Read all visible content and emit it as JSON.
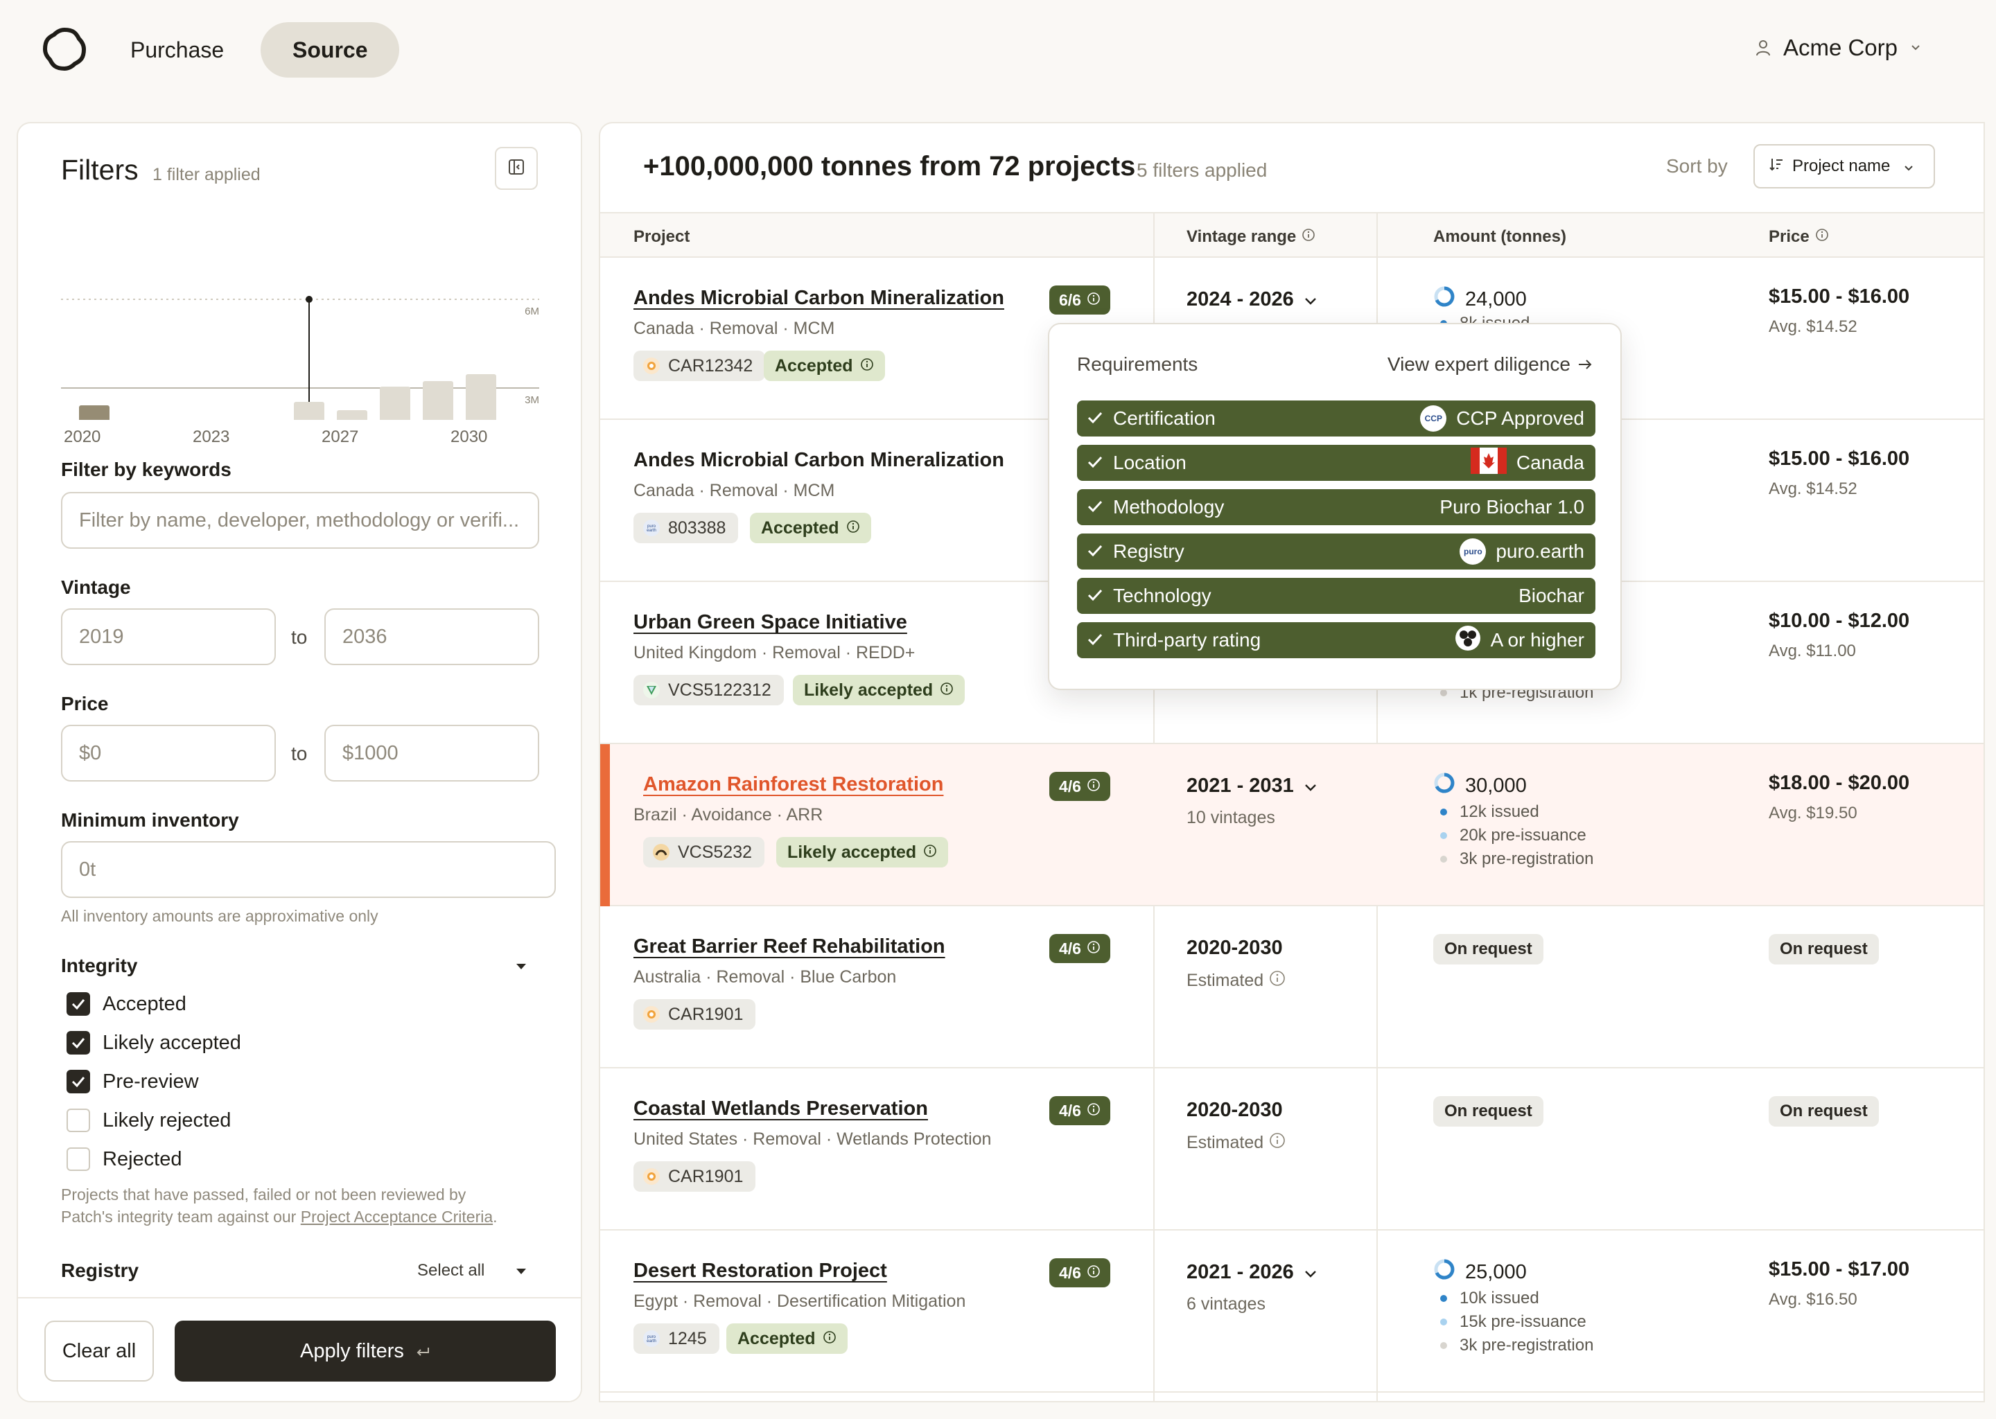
{
  "nav": {
    "tabs": [
      "Purchase",
      "Source"
    ],
    "account": "Acme Corp"
  },
  "filters": {
    "title": "Filters",
    "applied": "1 filter applied",
    "chart": {
      "y_ticks": [
        "6M",
        "3M"
      ],
      "x_ticks": [
        "2020",
        "2023",
        "2027",
        "2030"
      ]
    },
    "keywords": {
      "label": "Filter by keywords",
      "placeholder": "Filter by name, developer, methodology or verifi..."
    },
    "vintage": {
      "label": "Vintage",
      "from": "2019",
      "to_label": "to",
      "to": "2036"
    },
    "price": {
      "label": "Price",
      "from": "$0",
      "to_label": "to",
      "to": "$1000"
    },
    "inventory": {
      "label": "Minimum inventory",
      "value": "0t",
      "hint": "All inventory amounts are approximative only"
    },
    "integrity": {
      "label": "Integrity",
      "options": [
        {
          "label": "Accepted",
          "checked": true
        },
        {
          "label": "Likely accepted",
          "checked": true
        },
        {
          "label": "Pre-review",
          "checked": true
        },
        {
          "label": "Likely rejected",
          "checked": false
        },
        {
          "label": "Rejected",
          "checked": false
        }
      ],
      "hint_prefix": "Projects that have passed, failed or not been reviewed by",
      "hint_mid": "Patch's integrity team against our ",
      "hint_link": "Project Acceptance Criteria",
      "hint_suffix": "."
    },
    "registry": {
      "label": "Registry",
      "select_all": "Select all"
    },
    "clear_all": "Clear all",
    "apply": "Apply filters"
  },
  "results": {
    "title": "+100,000,000 tonnes from 72 projects",
    "applied": "5 filters applied",
    "sort_label": "Sort by",
    "sort_value": "Project name",
    "columns": [
      "Project",
      "Vintage range",
      "Amount (tonnes)",
      "Price"
    ],
    "rows": [
      {
        "name": "Andes Microbial Carbon Mineralization",
        "meta": "Canada · Removal · MCM",
        "registry_id": "CAR12342",
        "status": "Accepted",
        "score": "6/6",
        "vintage": "2024 - 2026",
        "vintage_sub": "",
        "amount": "24,000",
        "amount_lines": [
          "8k issued"
        ],
        "price": "$15.00 - $16.00",
        "avg": "Avg. $14.52"
      },
      {
        "name": "Andes Microbial Carbon Mineralization",
        "meta": "Canada · Removal · MCM",
        "registry_id": "803388",
        "status": "Accepted",
        "price": "$15.00 - $16.00",
        "avg": "Avg. $14.52"
      },
      {
        "name": "Urban Green Space Initiative",
        "meta": "United Kingdom · Removal · REDD+",
        "registry_id": "VCS5122312",
        "status": "Likely accepted",
        "amount_lines": [
          "1k pre-registration"
        ],
        "price": "$10.00 - $12.00",
        "avg": "Avg. $11.00"
      },
      {
        "name": "Amazon Rainforest Restoration",
        "meta": "Brazil  ·  Avoidance  ·  ARR",
        "registry_id": "VCS5232",
        "status": "Likely accepted",
        "score": "4/6",
        "vintage": "2021 - 2031",
        "vintage_sub": "10 vintages",
        "amount": "30,000",
        "amount_lines": [
          "12k issued",
          "20k pre-issuance",
          "3k pre-registration"
        ],
        "price": "$18.00 - $20.00",
        "avg": "Avg. $19.50"
      },
      {
        "name": "Great Barrier Reef Rehabilitation",
        "meta": "Australia  ·  Removal  ·  Blue Carbon",
        "registry_id": "CAR1901",
        "score": "4/6",
        "vintage": "2020-2030",
        "vintage_sub": "Estimated",
        "amount_onreq": "On request",
        "price_onreq": "On request"
      },
      {
        "name": "Coastal Wetlands Preservation",
        "meta": "United States  ·  Removal  ·  Wetlands Protection",
        "registry_id": "CAR1901",
        "score": "4/6",
        "vintage": "2020-2030",
        "vintage_sub": "Estimated",
        "amount_onreq": "On request",
        "price_onreq": "On request"
      },
      {
        "name": "Desert Restoration Project",
        "meta": "Egypt  ·  Removal  ·  Desertification Mitigation",
        "registry_id": "1245",
        "status": "Accepted",
        "score": "4/6",
        "vintage": "2021 - 2026",
        "vintage_sub": "6 vintages",
        "amount": "25,000",
        "amount_lines": [
          "10k issued",
          "15k pre-issuance",
          "3k pre-registration"
        ],
        "price": "$15.00 - $17.00",
        "avg": "Avg. $16.50"
      }
    ]
  },
  "popover": {
    "title": "Requirements",
    "link": "View expert diligence",
    "items": [
      {
        "label": "Certification",
        "value": "CCP Approved",
        "badge": "CCP"
      },
      {
        "label": "Location",
        "value": "Canada"
      },
      {
        "label": "Methodology",
        "value": "Puro Biochar 1.0"
      },
      {
        "label": "Registry",
        "value": "puro.earth",
        "badge": "puro"
      },
      {
        "label": "Technology",
        "value": "Biochar"
      },
      {
        "label": "Third-party rating",
        "value": "A or higher"
      }
    ]
  },
  "colors": {
    "accent_green": "#4d5e2f",
    "highlight_orange": "#ea6b3a",
    "status_green_bg": "#dfe8cd"
  }
}
